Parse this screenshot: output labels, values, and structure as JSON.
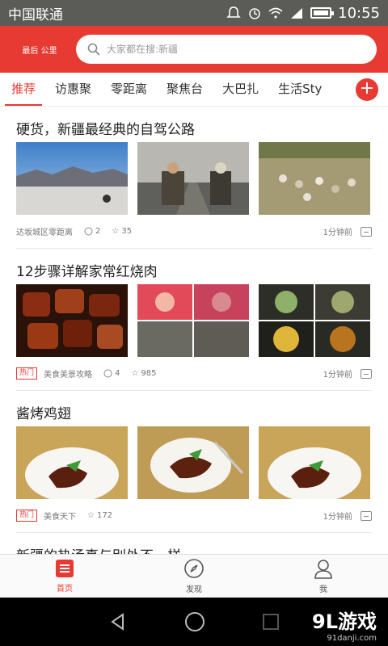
{
  "status_bar": {
    "carrier": "中国联通",
    "time": "10:55"
  },
  "header": {
    "logo_text": "最后 公里",
    "search_placeholder": "大家都在搜:新疆"
  },
  "tabs": [
    {
      "label": "推荐",
      "active": true
    },
    {
      "label": "访惠聚"
    },
    {
      "label": "零距离"
    },
    {
      "label": "聚焦台"
    },
    {
      "label": "大巴扎"
    },
    {
      "label": "生活Sty"
    }
  ],
  "tab_add_label": "+",
  "articles": [
    {
      "title": "硬货，新疆最经典的自驾公路",
      "images": [
        "desert-road-motorcycle-photo",
        "two-men-seated-on-road-photo",
        "sheep-herd-photo"
      ],
      "badge": "",
      "source": "达坂城区零距离",
      "comments": "2",
      "favorites": "35",
      "time": "1分钟前"
    },
    {
      "title": "12步骤详解家常红烧肉",
      "images": [
        "braised-pork-photo",
        "raw-pork-cuts-collage",
        "cooking-steps-collage"
      ],
      "badge": "热门",
      "source": "美食美景攻略",
      "comments": "4",
      "favorites": "985",
      "time": "1分钟前"
    },
    {
      "title": "酱烤鸡翅",
      "images": [
        "grilled-wings-plate-photo",
        "wings-plate-with-fork-photo",
        "grilled-wings-plate-photo"
      ],
      "badge": "热门",
      "source": "美食天下",
      "comments": "",
      "favorites": "172",
      "time": "1分钟前"
    },
    {
      "title": "新疆的热汤真与别处不一样",
      "images": [],
      "badge": "",
      "source": "",
      "comments": "",
      "favorites": "",
      "time": ""
    }
  ],
  "bottom_nav": [
    {
      "label": "首页",
      "icon": "home-icon",
      "active": true
    },
    {
      "label": "发现",
      "icon": "compass-icon"
    },
    {
      "label": "我",
      "icon": "user-icon"
    }
  ],
  "watermark": {
    "main": "9L游戏",
    "sub": "91danji.com"
  },
  "colors": {
    "brand_red": "#e63a33",
    "status_bar": "#5b5b58"
  }
}
